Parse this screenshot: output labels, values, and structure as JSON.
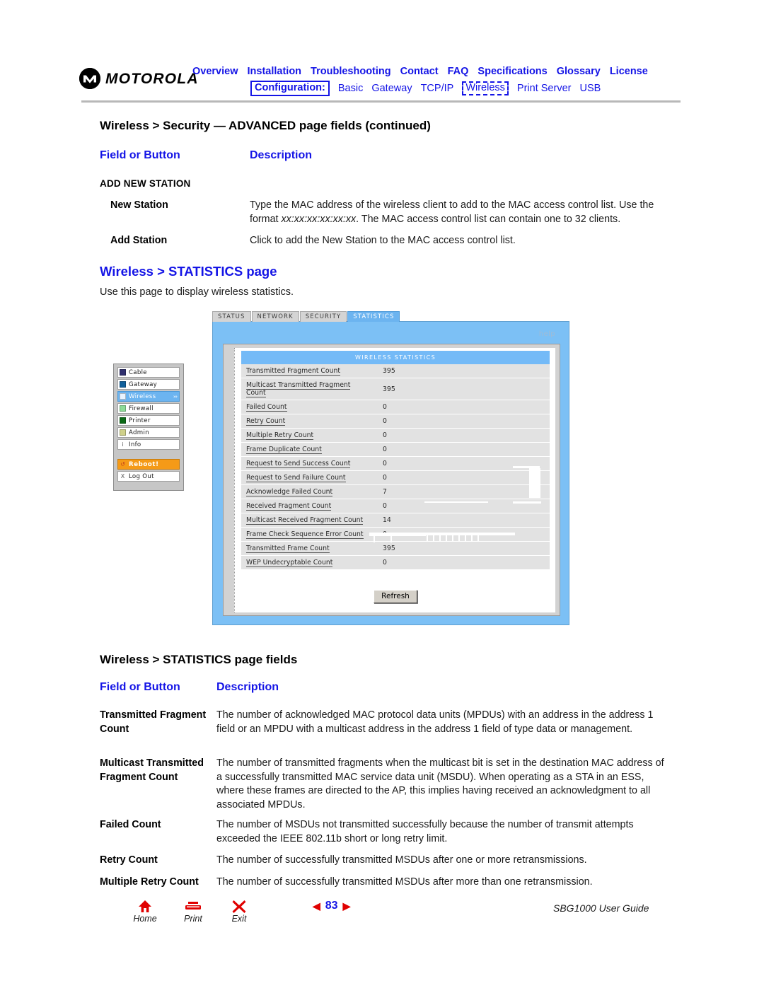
{
  "header": {
    "brand": "MOTOROLA",
    "nav_primary": [
      "Overview",
      "Installation",
      "Troubleshooting",
      "Contact",
      "FAQ",
      "Specifications",
      "Glossary",
      "License"
    ],
    "config_label": "Configuration:",
    "nav_secondary": [
      "Basic",
      "Gateway",
      "TCP/IP",
      "Wireless",
      "Print Server",
      "USB"
    ],
    "nav_secondary_selected": "Wireless"
  },
  "section_continued": {
    "table_title": "Wireless > Security — ADVANCED page fields (continued)",
    "col_field": "Field or Button",
    "col_desc": "Description",
    "group_label": "ADD NEW STATION",
    "rows": [
      {
        "term": "New Station",
        "desc_part1": "Type the MAC address of the wireless client to add to the MAC access control list. Use the format ",
        "desc_italic": "xx:xx:xx:xx:xx:xx",
        "desc_part2": ". The MAC access control list can contain one to 32 clients."
      },
      {
        "term": "Add Station",
        "desc_part1": "Click to add the New Station to the MAC access control list.",
        "desc_italic": "",
        "desc_part2": ""
      }
    ]
  },
  "section_statistics": {
    "heading": "Wireless > STATISTICS page",
    "intro": "Use this page to display wireless statistics."
  },
  "screenshot": {
    "tabs": [
      {
        "label": "STATUS",
        "active": false
      },
      {
        "label": "NETWORK",
        "active": false
      },
      {
        "label": "SECURITY",
        "active": false
      },
      {
        "label": "STATISTICS",
        "active": true
      }
    ],
    "help_label": "help",
    "panel_title": "WIRELESS STATISTICS",
    "stats": [
      {
        "name": "Transmitted Fragment Count",
        "value": "395"
      },
      {
        "name": "Multicast Transmitted Fragment Count",
        "value": "395"
      },
      {
        "name": "Failed Count",
        "value": "0"
      },
      {
        "name": "Retry Count",
        "value": "0"
      },
      {
        "name": "Multiple Retry Count",
        "value": "0"
      },
      {
        "name": "Frame Duplicate Count",
        "value": "0"
      },
      {
        "name": "Request to Send Success Count",
        "value": "0"
      },
      {
        "name": "Request to Send Failure Count",
        "value": "0"
      },
      {
        "name": "Acknowledge Failed Count",
        "value": "7"
      },
      {
        "name": "Received Fragment Count",
        "value": "0"
      },
      {
        "name": "Multicast Received Fragment Count",
        "value": "14"
      },
      {
        "name": "Frame Check Sequence Error Count",
        "value": "0"
      },
      {
        "name": "Transmitted Frame Count",
        "value": "395"
      },
      {
        "name": "WEP Undecryptable Count",
        "value": "0"
      }
    ],
    "refresh_label": "Refresh",
    "sidebar": [
      {
        "label": "Cable",
        "swatch": "#2f2f6e",
        "glyph": "",
        "selected": false,
        "kind": "nav"
      },
      {
        "label": "Gateway",
        "swatch": "#10609c",
        "glyph": "",
        "selected": false,
        "kind": "nav"
      },
      {
        "label": "Wireless",
        "swatch": "#eaf4ff",
        "glyph": "",
        "selected": true,
        "kind": "nav",
        "chevron": "»›"
      },
      {
        "label": "Firewall",
        "swatch": "#8ddb97",
        "glyph": "",
        "selected": false,
        "kind": "nav"
      },
      {
        "label": "Printer",
        "swatch": "#0b6a16",
        "glyph": "",
        "selected": false,
        "kind": "nav"
      },
      {
        "label": "Admin",
        "swatch": "#cfd08a",
        "glyph": "",
        "selected": false,
        "kind": "nav"
      },
      {
        "label": "Info",
        "swatch": "",
        "glyph": "i",
        "selected": false,
        "kind": "nav"
      },
      {
        "label": "Reboot!",
        "swatch": "",
        "glyph": "↺",
        "selected": false,
        "kind": "reboot"
      },
      {
        "label": "Log Out",
        "swatch": "",
        "glyph": "X",
        "selected": false,
        "kind": "nav"
      }
    ]
  },
  "section_fields": {
    "table_title": "Wireless > STATISTICS page fields",
    "col_field": "Field or Button",
    "col_desc": "Description",
    "rows": [
      {
        "term": "Transmitted Fragment Count",
        "desc": "The number of acknowledged MAC protocol data units (MPDUs) with an address in the address 1 field or an MPDU with a multicast address in the address 1 field of type data or management."
      },
      {
        "term": "Multicast Transmitted Fragment Count",
        "desc": "The number of transmitted fragments when the multicast bit is set in the destination MAC address of a successfully transmitted MAC service data unit (MSDU). When operating as a STA in an ESS, where these frames are directed to the AP, this implies having received an acknowledgment to all associated MPDUs."
      },
      {
        "term": "Failed Count",
        "desc": "The number of MSDUs not transmitted successfully because the number of transmit attempts exceeded the IEEE 802.11b short or long retry limit."
      },
      {
        "term": "Retry Count",
        "desc": "The number of successfully transmitted MSDUs after one or more retransmissions."
      },
      {
        "term": "Multiple Retry Count",
        "desc": "The number of successfully transmitted MSDUs after more than one retransmission."
      }
    ]
  },
  "footer": {
    "home_label": "Home",
    "print_label": "Print",
    "exit_label": "Exit",
    "page_number": "83",
    "prev_arrow": "◀",
    "next_arrow": "▶",
    "guide_title": "SBG1000 User Guide"
  }
}
